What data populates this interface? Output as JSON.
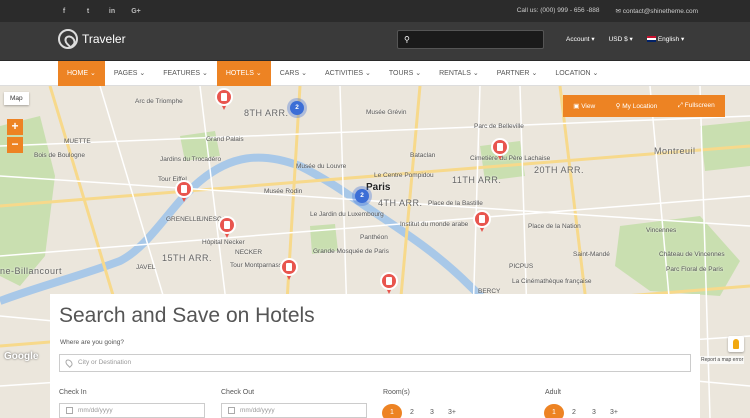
{
  "topbar": {
    "social": [
      "f",
      "t",
      "in",
      "G+"
    ],
    "phone": "Call us: (000) 999 - 656 -888",
    "email": "contact@shinetheme.com"
  },
  "header": {
    "logo_text": "Traveler",
    "search_placeholder": "",
    "account_label": "Account",
    "currency_label": "USD $",
    "language_label": "English"
  },
  "nav": {
    "items": [
      {
        "label": "HOME",
        "active": true
      },
      {
        "label": "PAGES",
        "active": false
      },
      {
        "label": "FEATURES",
        "active": false
      },
      {
        "label": "HOTELS",
        "active": true
      },
      {
        "label": "CARS",
        "active": false
      },
      {
        "label": "ACTIVITIES",
        "active": false
      },
      {
        "label": "TOURS",
        "active": false
      },
      {
        "label": "RENTALS",
        "active": false
      },
      {
        "label": "PARTNER",
        "active": false
      },
      {
        "label": "LOCATION",
        "active": false
      }
    ]
  },
  "map": {
    "map_tab": "Map",
    "zoom_in": "+",
    "zoom_out": "−",
    "view_label": "View",
    "my_location_label": "My Location",
    "fullscreen_label": "Fullscreen",
    "cluster_1": "2",
    "cluster_2": "2",
    "google_label": "Google",
    "report_label": "Report a map error",
    "labels": {
      "arc": "Arc de Triomphe",
      "arr8": "8TH ARR.",
      "grevin": "Musée Grévin",
      "palais": "Grand Palais",
      "louvre": "Musée du Louvre",
      "trocadero": "Jardins du Trocadéro",
      "rodin": "Musée Rodin",
      "eiffel": "Tour Eiffel",
      "grenelle": "GRENELLE",
      "invalides": "UNESCO",
      "necker": "Hôpital Necker",
      "arr15": "15TH ARR.",
      "montparnasse": "Tour Montparnasse",
      "luxembourg": "Le Jardin du Luxembourg",
      "pantheon": "Panthéon",
      "mosquee": "Grande Mosquée de Paris",
      "paris": "Paris",
      "arr4": "4TH ARR.",
      "arr11": "11TH ARR.",
      "arr20": "20TH ARR.",
      "pompidou": "Le Centre Pompidou",
      "bastille": "Place de la Bastille",
      "nation": "Place de la Nation",
      "institut": "Institut du monde arabe",
      "montreuil": "Montreuil",
      "vincennes": "Vincennes",
      "chateau": "Château de Vincennes",
      "cimetiere": "Cimetière du Père Lachaise",
      "belleville": "Parc de Belleville",
      "boulogne": "ne-Billancourt",
      "bercy": "BERCY",
      "cinematheque": "La Cinémathèque française",
      "saintmande": "Saint-Mandé",
      "picpus": "PICPUS",
      "parcfloral": "Parc Floral de Paris",
      "muette": "MUETTE",
      "boisboulogne": "Bois de Boulogne",
      "bataclan": "Bataclan",
      "javel": "JAVEL",
      "necker2": "NECKER"
    }
  },
  "search": {
    "title": "Search and Save on Hotels",
    "where_label": "Where are you going?",
    "dest_placeholder": "City or Destination",
    "checkin_label": "Check In",
    "checkout_label": "Check Out",
    "date_placeholder": "mm/dd/yyyy",
    "rooms_label": "Room(s)",
    "adult_label": "Adult",
    "rooms_options": [
      "1",
      "2",
      "3",
      "3+"
    ],
    "adult_options": [
      "1",
      "2",
      "3",
      "3+"
    ]
  },
  "colors": {
    "accent": "#ed8323",
    "pin": "#e8554e",
    "cluster": "#3c6ed6",
    "topbar": "#2b2b2b",
    "header": "#3a3a3a"
  }
}
